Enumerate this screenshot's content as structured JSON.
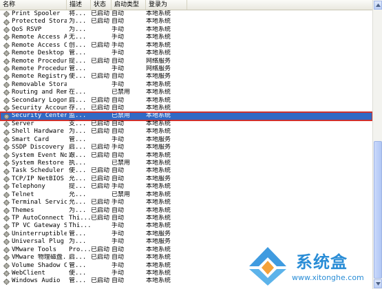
{
  "columns": [
    "名称",
    "描述",
    "状态",
    "启动类型",
    "登录为"
  ],
  "rows": [
    {
      "name": "Print Spooler",
      "desc": "将...",
      "state": "已启动",
      "start": "自动",
      "login": "本地系统"
    },
    {
      "name": "Protected Storage",
      "desc": "为...",
      "state": "已启动",
      "start": "自动",
      "login": "本地系统"
    },
    {
      "name": "QoS RSVP",
      "desc": "为...",
      "state": "",
      "start": "手动",
      "login": "本地系统"
    },
    {
      "name": "Remote Access Au...",
      "desc": "无...",
      "state": "",
      "start": "手动",
      "login": "本地系统"
    },
    {
      "name": "Remote Access Co...",
      "desc": "创...",
      "state": "已启动",
      "start": "手动",
      "login": "本地系统"
    },
    {
      "name": "Remote Desktop H...",
      "desc": "管...",
      "state": "",
      "start": "手动",
      "login": "本地系统"
    },
    {
      "name": "Remote Procedure...",
      "desc": "提...",
      "state": "已启动",
      "start": "自动",
      "login": "网络服务"
    },
    {
      "name": "Remote Procedure...",
      "desc": "管...",
      "state": "",
      "start": "手动",
      "login": "网络服务"
    },
    {
      "name": "Remote Registry",
      "desc": "使...",
      "state": "已启动",
      "start": "自动",
      "login": "本地服务"
    },
    {
      "name": "Removable Storage",
      "desc": "",
      "state": "",
      "start": "手动",
      "login": "本地系统"
    },
    {
      "name": "Routing and Remo...",
      "desc": "在...",
      "state": "",
      "start": "已禁用",
      "login": "本地系统"
    },
    {
      "name": "Secondary Logon",
      "desc": "启...",
      "state": "已启动",
      "start": "自动",
      "login": "本地系统"
    },
    {
      "name": "Security Account...",
      "desc": "存...",
      "state": "已启动",
      "start": "自动",
      "login": "本地系统"
    },
    {
      "name": "Security Center",
      "desc": "监...",
      "state": "",
      "start": "已禁用",
      "login": "本地系统",
      "selected": true
    },
    {
      "name": "Server",
      "desc": "支...",
      "state": "已启动",
      "start": "自动",
      "login": "本地系统"
    },
    {
      "name": "Shell Hardware D...",
      "desc": "为...",
      "state": "已启动",
      "start": "自动",
      "login": "本地系统"
    },
    {
      "name": "Smart Card",
      "desc": "管...",
      "state": "",
      "start": "手动",
      "login": "本地服务"
    },
    {
      "name": "SSDP Discovery S...",
      "desc": "启...",
      "state": "已启动",
      "start": "手动",
      "login": "本地服务"
    },
    {
      "name": "System Event Not...",
      "desc": "跟...",
      "state": "已启动",
      "start": "自动",
      "login": "本地系统"
    },
    {
      "name": "System Restore S...",
      "desc": "执...",
      "state": "",
      "start": "已禁用",
      "login": "本地系统"
    },
    {
      "name": "Task Scheduler",
      "desc": "使...",
      "state": "已启动",
      "start": "自动",
      "login": "本地系统"
    },
    {
      "name": "TCP/IP NetBIOS H...",
      "desc": "允...",
      "state": "已启动",
      "start": "自动",
      "login": "本地服务"
    },
    {
      "name": "Telephony",
      "desc": "提...",
      "state": "已启动",
      "start": "手动",
      "login": "本地系统"
    },
    {
      "name": "Telnet",
      "desc": "允...",
      "state": "",
      "start": "已禁用",
      "login": "本地系统"
    },
    {
      "name": "Terminal Services",
      "desc": "允...",
      "state": "已启动",
      "start": "手动",
      "login": "本地系统"
    },
    {
      "name": "Themes",
      "desc": "为...",
      "state": "已启动",
      "start": "自动",
      "login": "本地系统"
    },
    {
      "name": "TP AutoConnect S...",
      "desc": "Thi...",
      "state": "已启动",
      "start": "自动",
      "login": "本地系统"
    },
    {
      "name": "TP VC Gateway Se...",
      "desc": "Thi...",
      "state": "",
      "start": "手动",
      "login": "本地系统"
    },
    {
      "name": "Uninterruptible ...",
      "desc": "管...",
      "state": "",
      "start": "手动",
      "login": "本地服务"
    },
    {
      "name": "Universal Plug a...",
      "desc": "为...",
      "state": "",
      "start": "手动",
      "login": "本地服务"
    },
    {
      "name": "VMware Tools",
      "desc": "Pro...",
      "state": "已启动",
      "start": "自动",
      "login": "本地系统"
    },
    {
      "name": "VMware 物理磁盘...",
      "desc": "启...",
      "state": "已启动",
      "start": "自动",
      "login": "本地系统"
    },
    {
      "name": "Volume Shadow Copy",
      "desc": "管...",
      "state": "",
      "start": "手动",
      "login": "本地系统"
    },
    {
      "name": "WebClient",
      "desc": "使...",
      "state": "",
      "start": "手动",
      "login": "本地系统"
    },
    {
      "name": "Windows Audio",
      "desc": "管...",
      "state": "已启动",
      "start": "自动",
      "login": "本地系统"
    }
  ],
  "watermark": {
    "title": "系统盒",
    "url": "www.xitonghe.com"
  },
  "colors": {
    "selection": "#316ac5",
    "highlight_border": "#d0312d",
    "watermark": "#2a8dd6"
  },
  "icons": {
    "row": "gear-icon",
    "scroll_up": "arrow-up-icon",
    "scroll_down": "arrow-down-icon",
    "logo": "xitonghe-logo-icon"
  }
}
